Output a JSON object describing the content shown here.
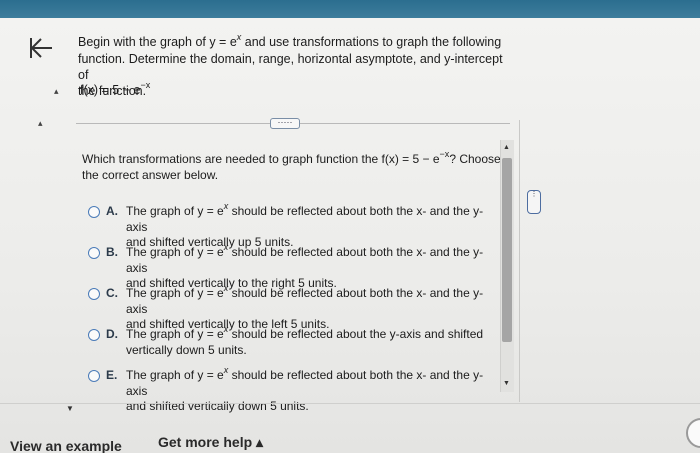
{
  "question": {
    "line1": "Begin with the graph of y = e",
    "line1_sup": "x",
    "line1_rest": " and use transformations to graph the following",
    "line2": "function. Determine the domain, range, horizontal asymptote, and y-intercept of",
    "line3": "the function.",
    "func_prefix": "f(x) = 5 − e",
    "func_sup": "−x"
  },
  "more_button": "·····",
  "prompt": {
    "text": "Which transformations are needed to graph function the f(x) = 5 − e",
    "sup": "−x",
    "rest": "? Choose",
    "line2": "the correct answer below."
  },
  "options": [
    {
      "letter": "A.",
      "l1a": "The graph of y = e",
      "sup": "x",
      "l1b": " should be reflected about both the x- and the y-axis",
      "l2": "and shifted vertically up 5 units."
    },
    {
      "letter": "B.",
      "l1a": "The graph of y = e",
      "sup": "x",
      "l1b": " should be reflected about both the x- and the y-axis",
      "l2": "and shifted vertically to the right 5 units."
    },
    {
      "letter": "C.",
      "l1a": "The graph of y = e",
      "sup": "x",
      "l1b": " should be reflected about both the x- and the y-axis",
      "l2": "and shifted vertically to the left 5 units."
    },
    {
      "letter": "D.",
      "l1a": "The graph of y = e",
      "sup": "x",
      "l1b": " should be reflected about the y-axis and shifted",
      "l2": "vertically down 5 units."
    },
    {
      "letter": "E.",
      "l1a": "The graph of y = e",
      "sup": "x",
      "l1b": " should be reflected about both the x- and the y-axis",
      "l2": "and shifted vertically down 5 units."
    }
  ],
  "footer": {
    "view_example": "View an example",
    "get_help": "Get more help ▴"
  },
  "icons": {
    "back": "back-arrow-icon",
    "scroll_up": "▲",
    "scroll_down": "▼",
    "handle": "⋮"
  },
  "colors": {
    "top_bar": "#2b6e8f",
    "radio_border": "#4a7bb8"
  }
}
